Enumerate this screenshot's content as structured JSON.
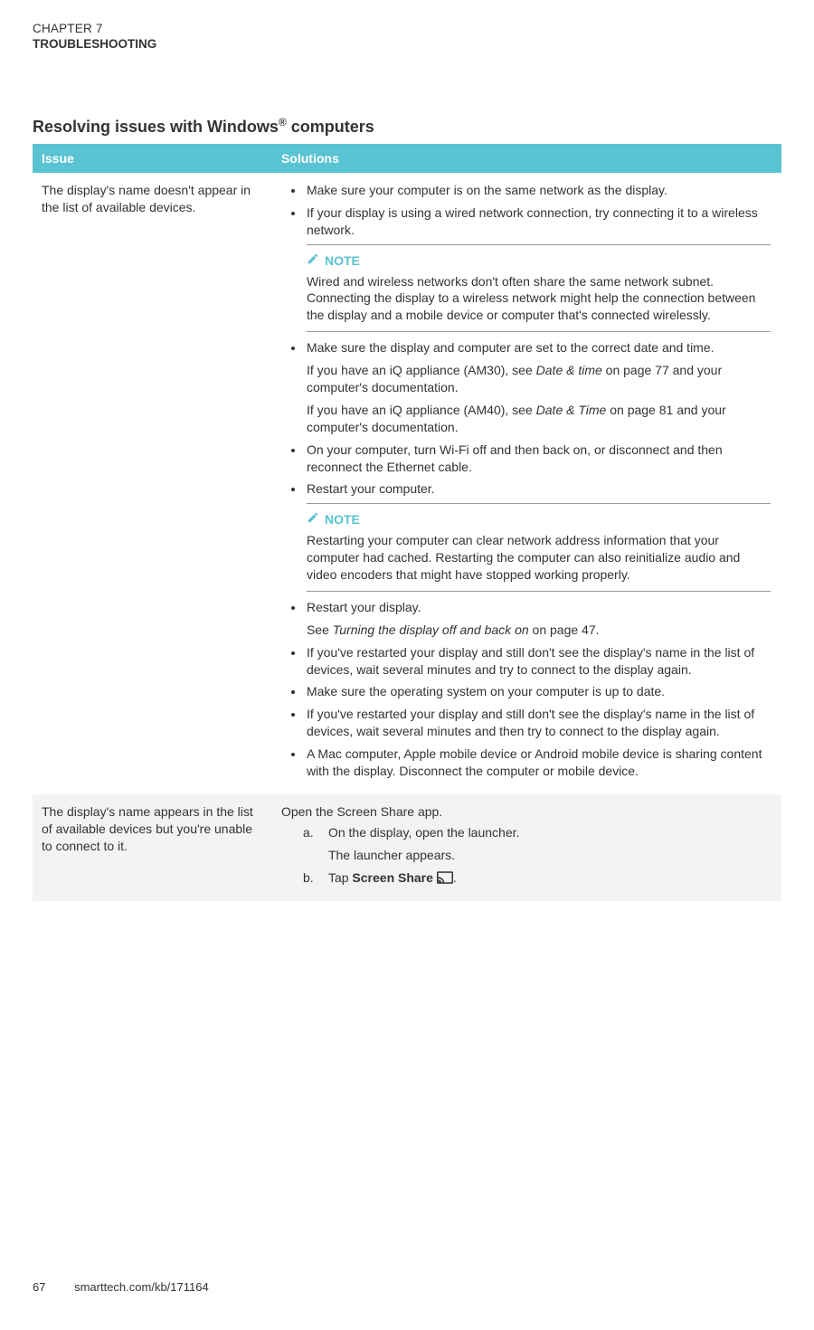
{
  "chapter": "CHAPTER 7",
  "chapterTitle": "TROUBLESHOOTING",
  "sectionHeadingPlain": "Resolving issues with Windows® computers",
  "tableHeaders": {
    "issue": "Issue",
    "solutions": "Solutions"
  },
  "row1": {
    "issue": "The display's name doesn't appear in the list of available devices.",
    "b1": "Make sure your computer is on the same network as the display.",
    "b2": "If your display is using a wired network connection, try connecting it to a wireless network.",
    "note1": {
      "label": "NOTE",
      "text": "Wired and wireless networks don't often share the same network subnet. Connecting the display to a wireless network might help the connection between the display and a mobile device or computer that's connected wirelessly."
    },
    "b3": "Make sure the display and computer are set to the correct date and time.",
    "b3_p1_a": "If you have an iQ appliance (AM30), see ",
    "b3_p1_i": "Date & time",
    "b3_p1_b": " on page 77 and your computer's documentation.",
    "b3_p2_a": "If you have an iQ appliance (AM40), see ",
    "b3_p2_i": "Date & Time",
    "b3_p2_b": " on page 81 and your computer's documentation.",
    "b4": "On your computer, turn Wi-Fi off and then back on, or disconnect and then reconnect the Ethernet cable.",
    "b5": "Restart your computer.",
    "note2": {
      "label": "NOTE",
      "text": "Restarting your computer can clear network address information that your computer had cached. Restarting the computer can also reinitialize audio and video encoders that might have stopped working properly."
    },
    "b6": "Restart your display.",
    "b6_p_a": "See ",
    "b6_p_i": "Turning the display off and back on",
    "b6_p_b": " on page 47.",
    "b7": "If you've restarted your display and still don't see the display's name in the list of devices, wait several minutes and try to connect to the display again.",
    "b8": "Make sure the operating system on your computer is up to date.",
    "b9": "If you've restarted your display and still don't see the display's name in the list of devices, wait several minutes and then try to connect to the display again.",
    "b10": "A Mac computer, Apple mobile device or Android mobile device is sharing content with the display. Disconnect the computer or mobile device."
  },
  "row2": {
    "issue": "The display's name appears in the list of available devices but you're unable to connect to it.",
    "intro": "Open the Screen Share app.",
    "stepA": "On the display, open the launcher.",
    "stepA_sub": "The launcher appears.",
    "stepB_a": "Tap ",
    "stepB_bold": "Screen Share",
    "stepB_b": "."
  },
  "footer": {
    "page": "67",
    "link": "smarttech.com/kb/171164"
  }
}
